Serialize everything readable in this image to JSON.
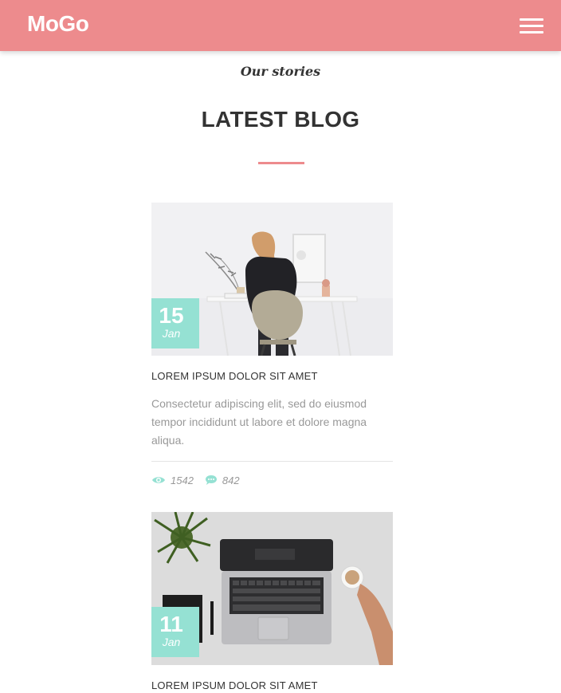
{
  "header": {
    "logo": "MoGo",
    "menu_icon": "hamburger-menu-icon",
    "background_color": "#ed8b8d"
  },
  "section": {
    "subtitle": "Our stories",
    "title": "LATEST BLOG",
    "accent_color": "#ed8b8d"
  },
  "posts": [
    {
      "day": "15",
      "month": "Jan",
      "title": "LOREM IPSUM DOLOR SIT AMET",
      "excerpt": "Consectetur adipiscing elit, sed do eiusmod tempor incididunt ut labore et dolore magna aliqua.",
      "views": "1542",
      "comments": "842",
      "image": "woman-at-desk-photo"
    },
    {
      "day": "11",
      "month": "Jan",
      "title": "LOREM IPSUM DOLOR SIT AMET",
      "image": "laptop-on-desk-photo"
    }
  ],
  "icons": {
    "views": "eye-icon",
    "comments": "comment-icon"
  },
  "badge_color": "#95e1d3"
}
